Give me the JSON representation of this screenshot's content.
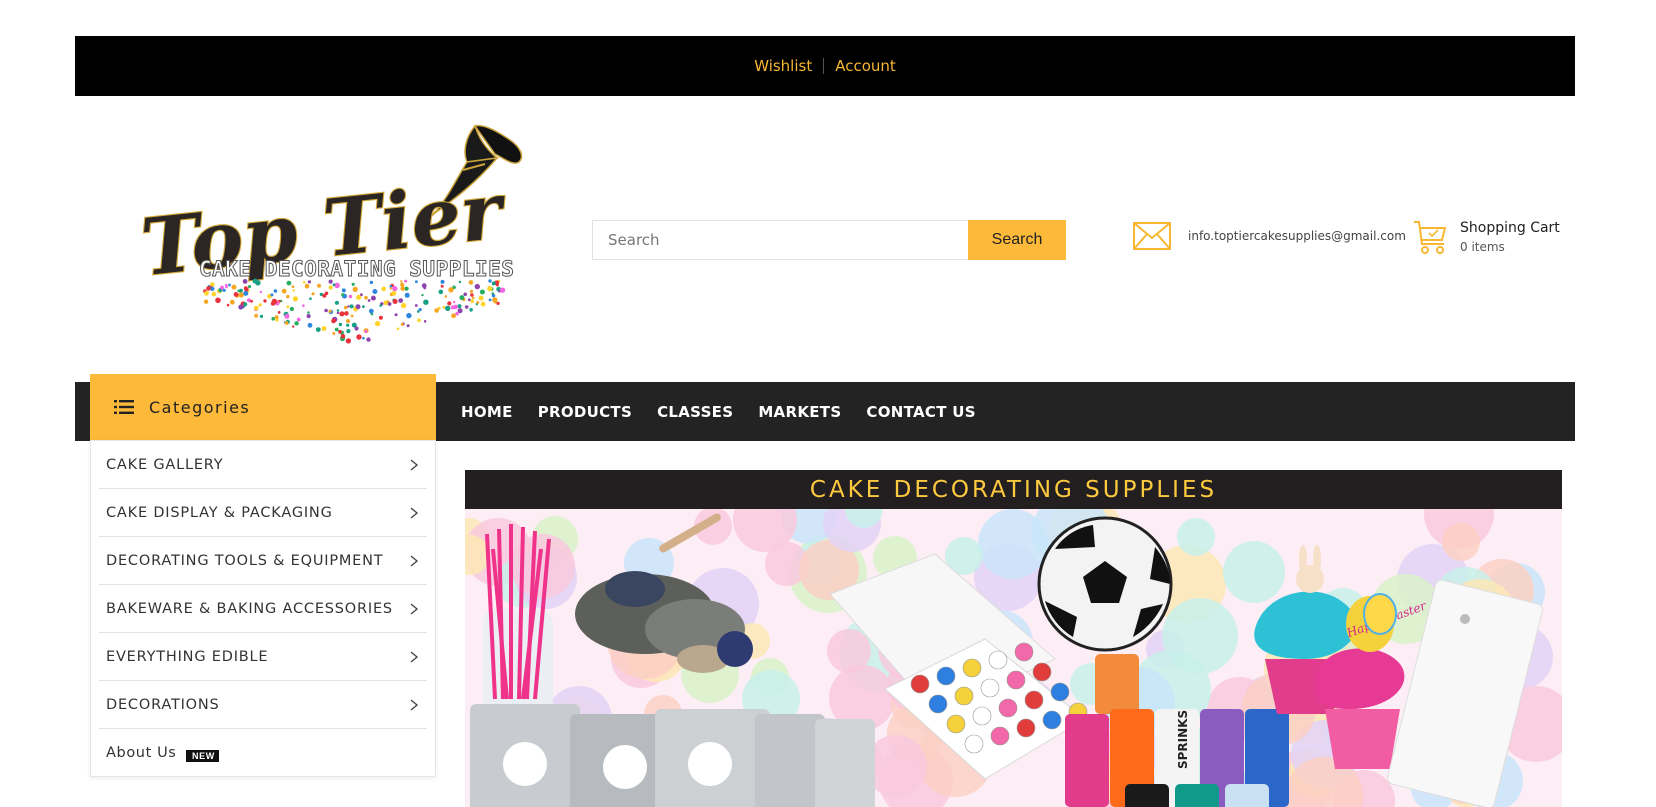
{
  "topbar": {
    "wishlist": "Wishlist",
    "account": "Account"
  },
  "logo": {
    "line1": "Top Tier",
    "line2": "CAKE DECORATING SUPPLIES"
  },
  "search": {
    "placeholder": "Search",
    "button": "Search"
  },
  "contact": {
    "email": "info.toptiercakesupplies@gmail.com"
  },
  "cart": {
    "title": "Shopping Cart",
    "count": "0 items"
  },
  "categories": {
    "header": "Categories",
    "items": [
      {
        "label": "CAKE GALLERY"
      },
      {
        "label": "CAKE DISPLAY & PACKAGING"
      },
      {
        "label": "DECORATING TOOLS & EQUIPMENT"
      },
      {
        "label": "BAKEWARE & BAKING ACCESSORIES"
      },
      {
        "label": "EVERYTHING EDIBLE"
      },
      {
        "label": "DECORATIONS"
      },
      {
        "label": "About Us",
        "badge": "NEW"
      }
    ]
  },
  "nav": {
    "items": [
      "HOME",
      "PRODUCTS",
      "CLASSES",
      "MARKETS",
      "CONTACT US"
    ]
  },
  "banner": {
    "title": "CAKE DECORATING SUPPLIES",
    "jar_label": "SPRINKS",
    "cupcake_topper": "Happy Easter"
  },
  "colors": {
    "accent": "#fdb93a",
    "topbar_link": "#f7b733",
    "dark": "#232323",
    "black": "#000000"
  }
}
